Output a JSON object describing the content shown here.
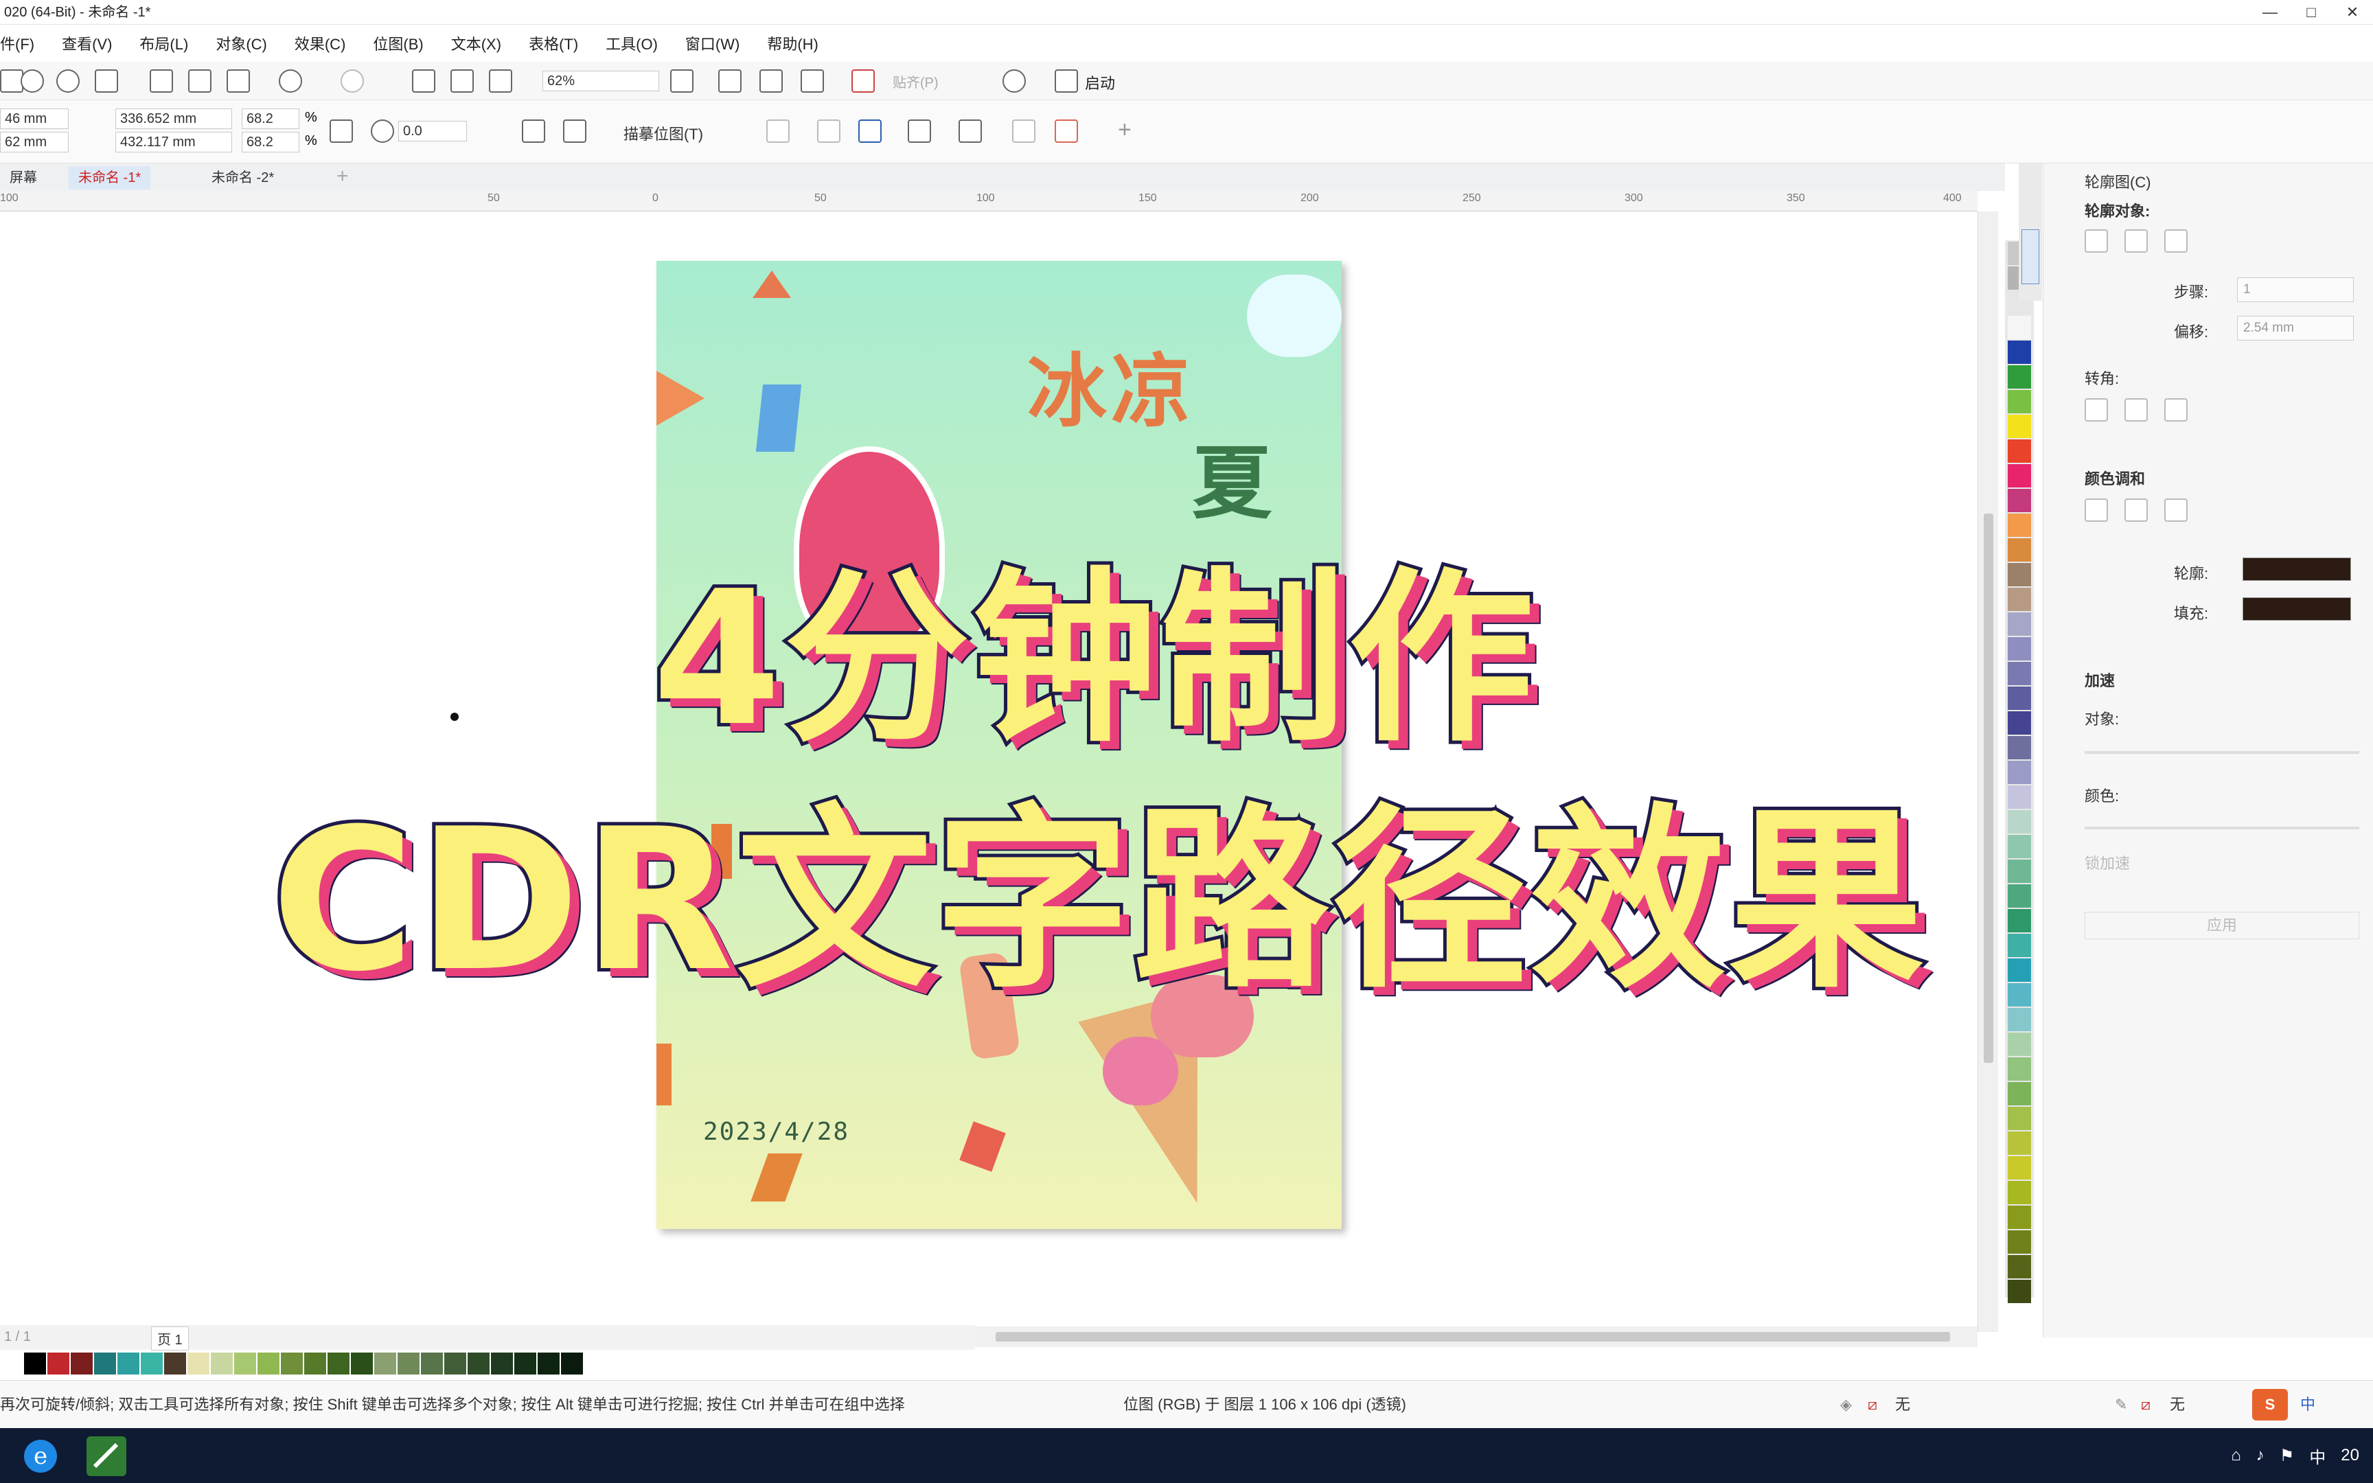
{
  "window": {
    "title": "020 (64-Bit) - 未命名 -1*",
    "controls": [
      "—",
      "□",
      "✕"
    ]
  },
  "menu": [
    "件(F)",
    "查看(V)",
    "布局(L)",
    "对象(C)",
    "效果(C)",
    "位图(B)",
    "文本(X)",
    "表格(T)",
    "工具(O)",
    "窗口(W)",
    "帮助(H)"
  ],
  "toolbar": {
    "zoom": "62%",
    "launch_label": "启动",
    "paste_label": "贴齐(P)"
  },
  "property_bar": {
    "x_value": "46 mm",
    "y_value": "62 mm",
    "width": "336.652 mm",
    "height": "432.117 mm",
    "scale_x": "68.2",
    "scale_y": "68.2",
    "percent": "%",
    "rotation": "0.0",
    "trace_label": "描摹位图(T)"
  },
  "doc_tabs": [
    "屏幕",
    "未命名 -1*",
    "未命名 -2*"
  ],
  "ruler_labels": [
    "100",
    "50",
    "0",
    "50",
    "100",
    "150",
    "200",
    "250",
    "300",
    "350",
    "400"
  ],
  "poster": {
    "title_line1": "冰凉",
    "title_line2": "夏",
    "date": "2023/4/28"
  },
  "overlay": {
    "line1": "4分钟制作",
    "line2": "CDR文字路径效果"
  },
  "right_panel": {
    "title": "轮廓图(C)",
    "outline_object": "轮廓对象:",
    "step_label": "步骤:",
    "step_value": "1",
    "offset_label": "偏移:",
    "offset_value": "2.54 mm",
    "corner_label": "转角:",
    "color_blend": "颜色调和",
    "outline_label": "轮廓:",
    "fill_label": "填充:",
    "accel_label": "加速",
    "object_label": "对象:",
    "color_label": "颜色:",
    "lock_accel": "锁加速",
    "apply": "应用",
    "outline_color": "#2c1b12",
    "fill_color": "#2c1b12"
  },
  "page_nav": {
    "page_label": "页 1",
    "page_count": "1 / 1"
  },
  "status": {
    "hint": "再次可旋转/倾斜; 双击工具可选择所有对象; 按住 Shift 键单击可选择多个对象; 按住 Alt 键单击可进行挖掘; 按住 Ctrl 并单击可在组中选择",
    "layer_info": "位图 (RGB) 于 图层 1 106 x 106 dpi (透镜)",
    "fill_none": "无",
    "outline_none": "无"
  },
  "tray": {
    "ime": "中",
    "time": "20"
  },
  "palette_colors": [
    "#c8c8c8",
    "#b4b4b4",
    "#e6e6e6",
    "#f5f5f5",
    "#1f3fa8",
    "#2e9d3a",
    "#7ac143",
    "#f3e21b",
    "#e9432b",
    "#e8246b",
    "#c43a7d",
    "#f2994a",
    "#d98a3d",
    "#9b8168",
    "#b69a84",
    "#a6a6c8",
    "#8e8ec0",
    "#7a7ab0",
    "#5d5da0",
    "#444490",
    "#6f6f9f",
    "#9b9bc7",
    "#c4c4de",
    "#b8d6c9",
    "#8ec7ad",
    "#6fb795",
    "#4ea87e",
    "#2e986a",
    "#3fb0a5",
    "#24a0b5",
    "#58b6c7",
    "#86c7cc",
    "#a9d1a9",
    "#92c37f",
    "#7db45a",
    "#a3c04a",
    "#b7c43a",
    "#c9c92a",
    "#a8b820",
    "#8a9a1a",
    "#70801a",
    "#556418",
    "#3d4a14"
  ],
  "strip_colors": [
    "#ffffff",
    "#000000",
    "#c0282d",
    "#7a1e1e",
    "#1e7a7a",
    "#2ea0a0",
    "#3ab5a5",
    "#4b3a2a",
    "#e8e2b0",
    "#c8d7a0",
    "#a8c870",
    "#8fb850",
    "#708f3a",
    "#567a2a",
    "#3f6620",
    "#2a4f18",
    "#8aa070",
    "#6f8a58",
    "#58744a",
    "#425e38",
    "#2f4a28",
    "#1f3a20",
    "#163018",
    "#0e2410",
    "#0a1a0c"
  ]
}
